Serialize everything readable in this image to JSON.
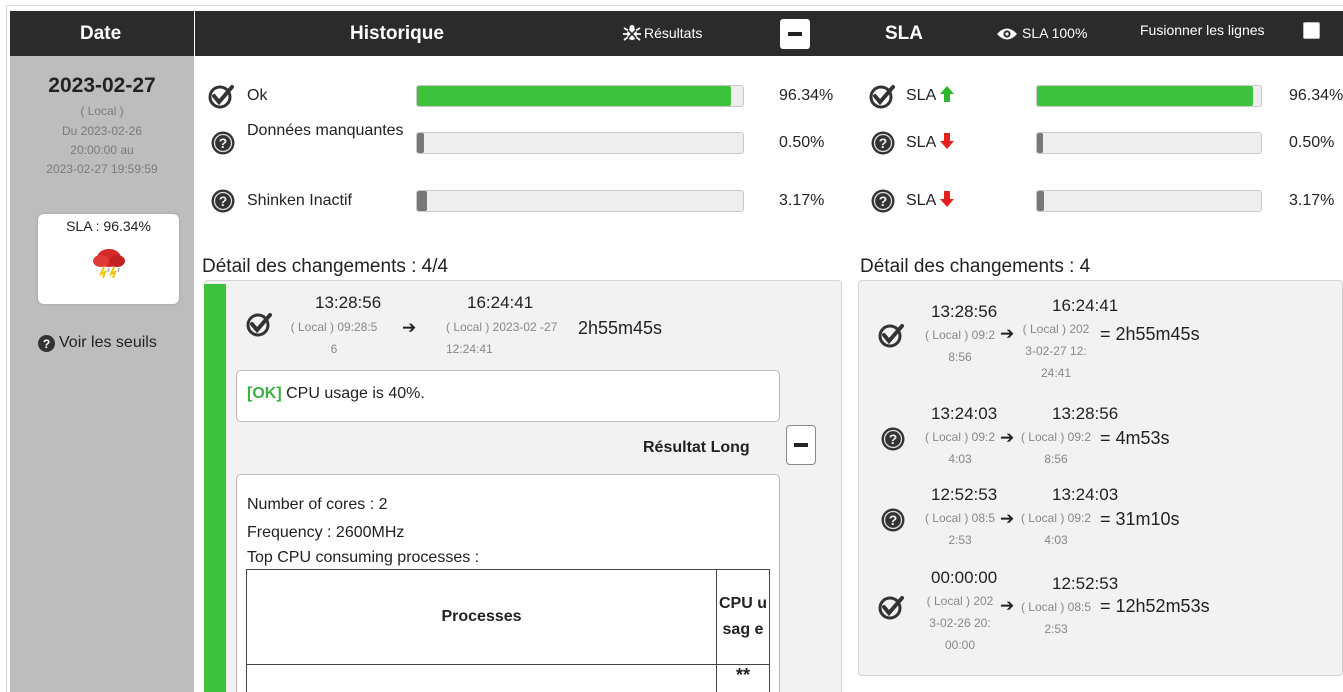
{
  "header": {
    "date": "Date",
    "historique": "Historique",
    "resultats": "Résultats",
    "sla": "SLA",
    "sla100": "SLA 100%",
    "fusion": "Fusionner les lignes"
  },
  "left": {
    "date": "2023-02-27",
    "local": "( Local )",
    "du": "Du 2023-02-26",
    "time_au": "20:00:00 au",
    "end": "2023-02-27 19:59:59",
    "sla_label": "SLA : 96.34%",
    "seuils": "Voir les seuils"
  },
  "rows": [
    {
      "label": "Ok",
      "pct": "96.34%",
      "fill": 96.34,
      "color": "#3cc23c",
      "status": "ok"
    },
    {
      "label": "Données manquantes",
      "pct": "0.50%",
      "fill": 0.5,
      "color": "#777777",
      "status": "unknown"
    },
    {
      "label": "Shinken Inactif",
      "pct": "3.17%",
      "fill": 3.17,
      "color": "#777777",
      "status": "unknown"
    }
  ],
  "sla_rows": [
    {
      "label": "SLA",
      "pct": "96.34%",
      "fill": 96.34,
      "color": "#3cc23c",
      "dir": "up"
    },
    {
      "label": "SLA",
      "pct": "0.50%",
      "fill": 0.5,
      "color": "#777777",
      "dir": "down"
    },
    {
      "label": "SLA",
      "pct": "3.17%",
      "fill": 3.17,
      "color": "#777777",
      "dir": "down"
    }
  ],
  "detail_left": {
    "title": "Détail des changements : 4/4",
    "start": "13:28:56",
    "end": "16:24:41",
    "start_local": "( Local ) 09:28:5 6",
    "end_local": "( Local ) 2023-02 -27 12:24:41",
    "duration": "2h55m45s",
    "ok_tag": "[OK]",
    "output": " CPU usage is 40%.",
    "long_label": "Résultat Long",
    "long_lines": [
      "Number of cores : 2",
      "Frequency : 2600MHz",
      "Top CPU consuming processes :"
    ],
    "table_headers": [
      "Processes",
      "CPU usag e"
    ],
    "next_cell": "**"
  },
  "detail_right": {
    "title": "Détail des changements : 4",
    "items": [
      {
        "start": "13:28:56",
        "end": "16:24:41",
        "sl": "( Local ) 09:2 8:56",
        "el": "( Local ) 202 3-02-27 12: 24:41",
        "dur": "2h55m45s",
        "status": "ok"
      },
      {
        "start": "13:24:03",
        "end": "13:28:56",
        "sl": "( Local ) 09:2 4:03",
        "el": "( Local ) 09:2 8:56",
        "dur": "4m53s",
        "status": "unknown"
      },
      {
        "start": "12:52:53",
        "end": "13:24:03",
        "sl": "( Local ) 08:5 2:53",
        "el": "( Local ) 09:2 4:03",
        "dur": "31m10s",
        "status": "unknown"
      },
      {
        "start": "00:00:00",
        "end": "12:52:53",
        "sl": "( Local ) 202 3-02-26 20: 00:00",
        "el": "( Local ) 08:5 2:53",
        "dur": "12h52m53s",
        "status": "ok"
      }
    ]
  }
}
